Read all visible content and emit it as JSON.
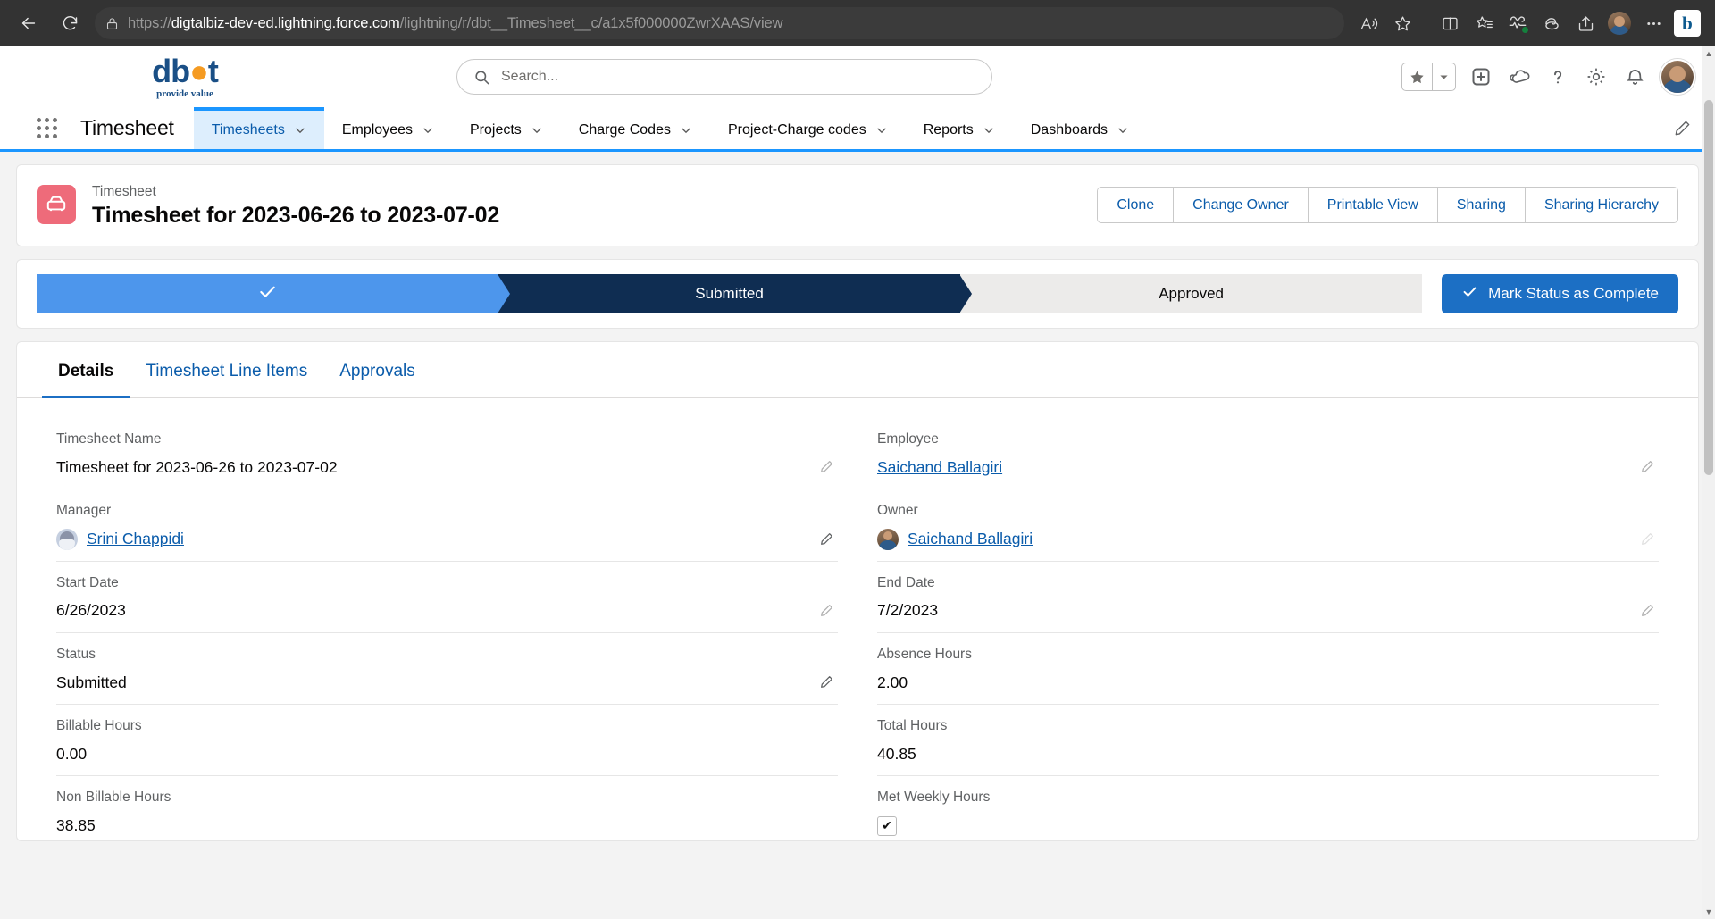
{
  "browser": {
    "back_label": "Back",
    "reload_label": "Refresh",
    "lock_icon": "lock-icon",
    "url_prefix": "https://",
    "url_host": "digtalbiz-dev-ed.lightning.force.com",
    "url_path": "/lightning/r/dbt__Timesheet__c/a1x5f000000ZwrXAAS/view",
    "url_full": "https://digtalbiz-dev-ed.lightning.force.com/lightning/r/dbt__Timesheet__c/a1x5f000000ZwrXAAS/view",
    "icons": [
      "read-aloud-icon",
      "favorite-star-icon",
      "split-screen-icon",
      "collections-icon",
      "browser-essentials-icon",
      "copilot-icon",
      "share-icon",
      "profile-avatar-icon",
      "settings-more-icon",
      "bing-chat-icon"
    ]
  },
  "sf_header": {
    "logo_text": "dbt",
    "logo_tagline": "provide value",
    "search_placeholder": "Search...",
    "search_value": "",
    "favorites_label": "Add to Favorites",
    "icons": [
      "favorites-star-icon",
      "favorites-caret-icon",
      "global-actions-icon",
      "service-cloud-icon",
      "help-icon",
      "setup-gear-icon",
      "notifications-bell-icon",
      "user-avatar-icon"
    ]
  },
  "nav": {
    "app_launcher": "app-launcher-icon",
    "app_name": "Timesheet",
    "items": [
      {
        "label": "Timesheets",
        "active": true,
        "has_caret": true
      },
      {
        "label": "Employees",
        "active": false,
        "has_caret": true
      },
      {
        "label": "Projects",
        "active": false,
        "has_caret": true
      },
      {
        "label": "Charge Codes",
        "active": false,
        "has_caret": true
      },
      {
        "label": "Project-Charge codes",
        "active": false,
        "has_caret": true
      },
      {
        "label": "Reports",
        "active": false,
        "has_caret": true
      },
      {
        "label": "Dashboards",
        "active": false,
        "has_caret": true
      }
    ],
    "edit_pencil": "edit-nav-pencil-icon"
  },
  "record": {
    "object_label": "Timesheet",
    "title": "Timesheet for 2023-06-26 to 2023-07-02",
    "icon": "timesheet-record-icon",
    "icon_color": "#ee6b7a",
    "actions": [
      "Clone",
      "Change Owner",
      "Printable View",
      "Sharing",
      "Sharing Hierarchy"
    ]
  },
  "path": {
    "steps": [
      {
        "label": "",
        "state": "done",
        "icon": "check-icon"
      },
      {
        "label": "Submitted",
        "state": "current"
      },
      {
        "label": "Approved",
        "state": "todo"
      }
    ],
    "button_label": "Mark Status as Complete",
    "button_icon": "check-icon",
    "button_color": "#1c6fc4",
    "done_color": "#4d96ec",
    "current_color": "#0f2d52",
    "todo_color": "#ecebea"
  },
  "tabs": [
    {
      "label": "Details",
      "active": true
    },
    {
      "label": "Timesheet Line Items",
      "active": false
    },
    {
      "label": "Approvals",
      "active": false
    }
  ],
  "details": {
    "left": [
      {
        "label": "Timesheet Name",
        "value": "Timesheet for 2023-06-26 to 2023-07-02",
        "type": "text",
        "editable": true
      },
      {
        "label": "Manager",
        "value": "Srini Chappidi",
        "type": "link-avatar",
        "avatar": "robot",
        "editable": true
      },
      {
        "label": "Start Date",
        "value": "6/26/2023",
        "type": "text",
        "editable": true
      },
      {
        "label": "Status",
        "value": "Submitted",
        "type": "text",
        "editable": true
      },
      {
        "label": "Billable Hours",
        "value": "0.00",
        "type": "text",
        "editable": false
      },
      {
        "label": "Non Billable Hours",
        "value": "38.85",
        "type": "text",
        "editable": false
      }
    ],
    "right": [
      {
        "label": "Employee",
        "value": "Saichand Ballagiri",
        "type": "link",
        "editable": true
      },
      {
        "label": "Owner",
        "value": "Saichand Ballagiri",
        "type": "link-avatar",
        "avatar": "photo",
        "editable": false
      },
      {
        "label": "End Date",
        "value": "7/2/2023",
        "type": "text",
        "editable": true
      },
      {
        "label": "Absence Hours",
        "value": "2.00",
        "type": "text",
        "editable": false
      },
      {
        "label": "Total Hours",
        "value": "40.85",
        "type": "text",
        "editable": false
      },
      {
        "label": "Met Weekly Hours",
        "value": "✔",
        "type": "checkbox",
        "editable": false
      }
    ]
  }
}
